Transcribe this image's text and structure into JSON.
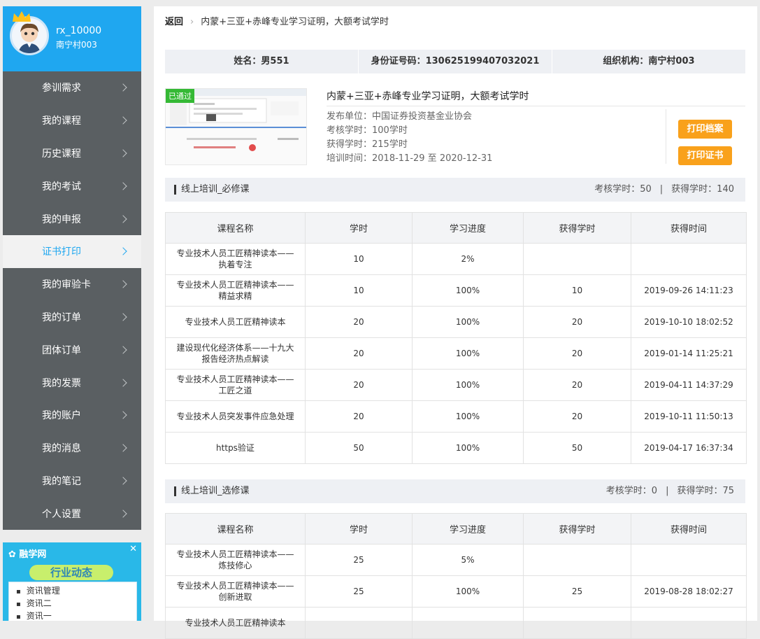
{
  "user": {
    "name": "rx_10000",
    "org": "南宁村003"
  },
  "menu": [
    "参训需求",
    "我的课程",
    "历史课程",
    "我的考试",
    "我的申报",
    "证书打印",
    "我的审验卡",
    "我的订单",
    "团体订单",
    "我的发票",
    "我的账户",
    "我的消息",
    "我的笔记",
    "个人设置"
  ],
  "active_menu": "证书打印",
  "ad": {
    "logo": "融学网",
    "title": "行业动态",
    "items": [
      "资讯管理",
      "资讯二",
      "资讯一"
    ]
  },
  "breadcrumb": {
    "back": "返回",
    "current": "内蒙+三亚+赤峰专业学习证明，大额考试学时"
  },
  "info": {
    "name": "姓名：男551",
    "id": "身份证号码：130625199407032021",
    "org": "组织机构：南宁村003"
  },
  "cert": {
    "badge": "已通过",
    "title": "内蒙+三亚+赤峰专业学习证明，大额考试学时",
    "publisher": "发布单位：中国证券投资基金业协会",
    "required_hours": "考核学时：100学时",
    "earned_hours": "获得学时：215学时",
    "period": "培训时间：2018-11-29 至 2020-12-31",
    "btn_archive": "打印档案",
    "btn_cert": "打印证书"
  },
  "table_headers": [
    "课程名称",
    "学时",
    "学习进度",
    "获得学时",
    "获得时间"
  ],
  "sections": [
    {
      "title": "线上培训_必修课",
      "assess": "考核学时：50",
      "earned": "获得学时：140",
      "rows": [
        [
          "专业技术人员工匠精神读本——执着专注",
          "10",
          "2%",
          "",
          ""
        ],
        [
          "专业技术人员工匠精神读本——精益求精",
          "10",
          "100%",
          "10",
          "2019-09-26 14:11:23"
        ],
        [
          "专业技术人员工匠精神读本",
          "20",
          "100%",
          "20",
          "2019-10-10 18:02:52"
        ],
        [
          "建设现代化经济体系——十九大报告经济热点解读",
          "20",
          "100%",
          "20",
          "2019-01-14 11:25:21"
        ],
        [
          "专业技术人员工匠精神读本——工匠之道",
          "20",
          "100%",
          "20",
          "2019-04-11 14:37:29"
        ],
        [
          "专业技术人员突发事件应急处理",
          "20",
          "100%",
          "20",
          "2019-10-11 11:50:13"
        ],
        [
          "https验证",
          "50",
          "100%",
          "50",
          "2019-04-17 16:37:34"
        ]
      ]
    },
    {
      "title": "线上培训_选修课",
      "assess": "考核学时：0",
      "earned": "获得学时：75",
      "rows": [
        [
          "专业技术人员工匠精神读本——炼技修心",
          "25",
          "5%",
          "",
          ""
        ],
        [
          "专业技术人员工匠精神读本——创新进取",
          "25",
          "100%",
          "25",
          "2019-08-28 18:02:27"
        ],
        [
          "专业技术人员工匠精神读本",
          "",
          "",
          "",
          ""
        ]
      ]
    }
  ],
  "colors": {
    "accent": "#1fa7f0",
    "sidebar": "#5a5f62",
    "button": "#f9a11b",
    "passed": "#35b935"
  }
}
